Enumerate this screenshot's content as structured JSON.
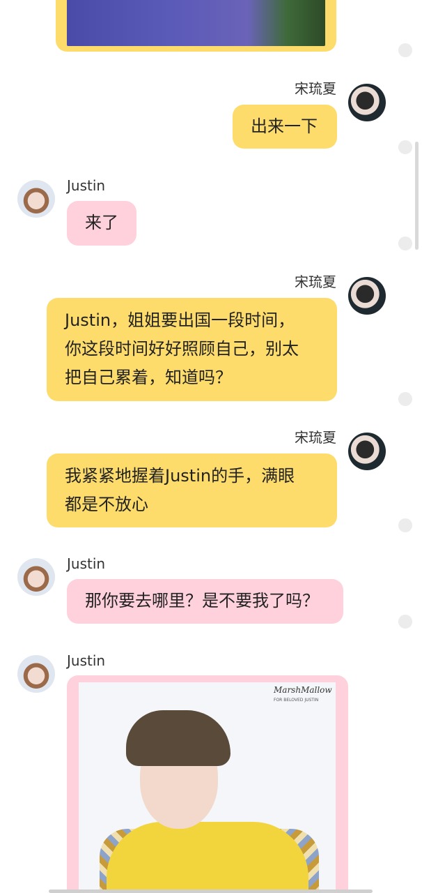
{
  "messages": [
    {
      "sender": "宋琉夏",
      "side": "right",
      "type": "text",
      "text": "出来一下"
    },
    {
      "sender": "Justin",
      "side": "left",
      "type": "text",
      "text": "来了"
    },
    {
      "sender": "宋琉夏",
      "side": "right",
      "type": "text",
      "lines": [
        "Justin，姐姐要出国一段时间，",
        "你这段时间好好照顾自己，别太",
        "把自己累着，知道吗？"
      ]
    },
    {
      "sender": "宋琉夏",
      "side": "right",
      "type": "text",
      "lines": [
        "我紧紧地握着Justin的手，满眼",
        "都是不放心"
      ]
    },
    {
      "sender": "Justin",
      "side": "left",
      "type": "text",
      "text": "那你要去哪里？是不要我了吗？"
    },
    {
      "sender": "Justin",
      "side": "left",
      "type": "image",
      "image_caption": "MarshMallow",
      "image_subcaption": "FOR BELOVED JUSTIN"
    }
  ],
  "colors": {
    "right_bubble": "#fddc6c",
    "left_bubble": "#ffd1dc",
    "name_text": "#333333"
  }
}
